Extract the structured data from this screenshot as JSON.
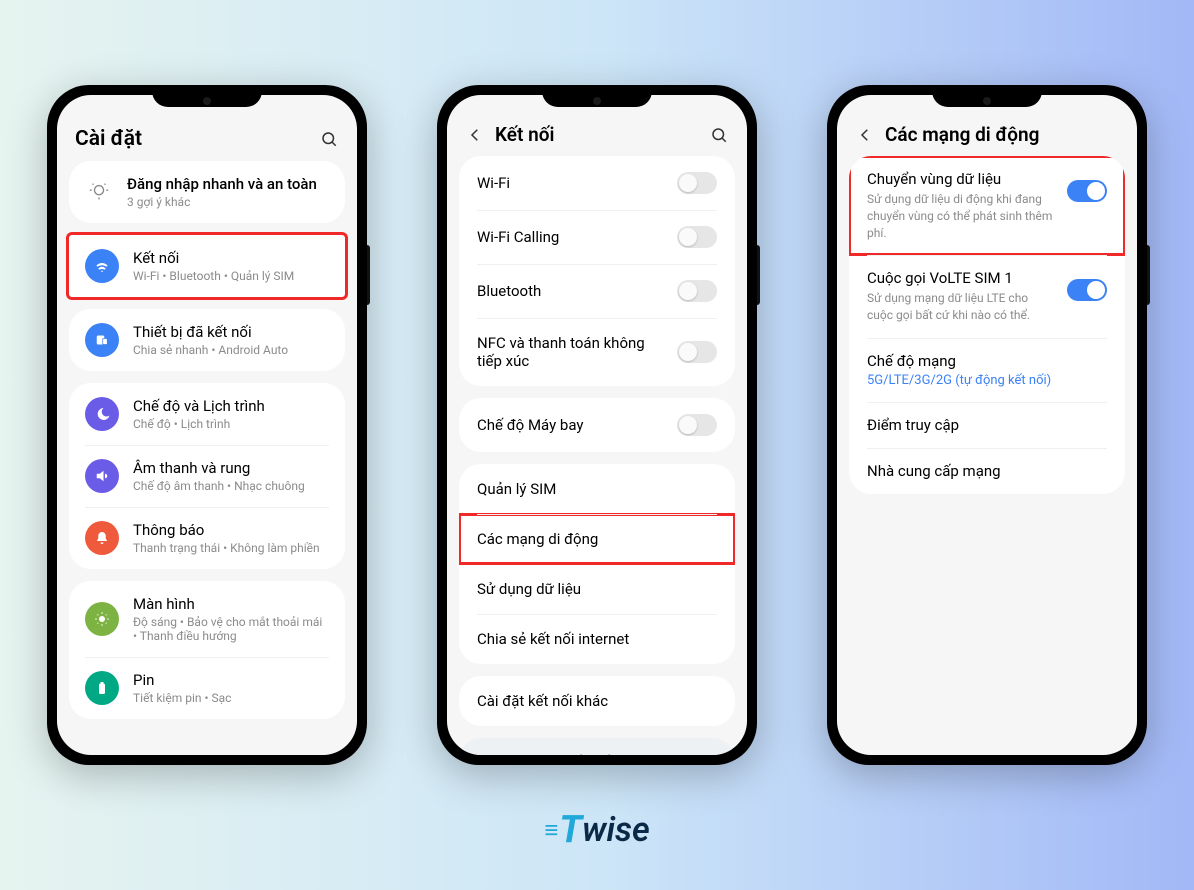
{
  "watermark": {
    "t": "T",
    "wise": "wise"
  },
  "phone1": {
    "title": "Cài đặt",
    "tip": {
      "title": "Đăng nhập nhanh và an toàn",
      "sub": "3 gợi ý khác"
    },
    "rows": [
      {
        "title": "Kết nối",
        "sub": "Wi-Fi • Bluetooth • Quản lý SIM",
        "color": "#3b82f6",
        "icon": "wifi",
        "hl": true
      },
      {
        "title": "Thiết bị đã kết nối",
        "sub": "Chia sẻ nhanh • Android Auto",
        "color": "#3b82f6",
        "icon": "devices"
      }
    ],
    "rows2": [
      {
        "title": "Chế độ và Lịch trình",
        "sub": "Chế độ • Lịch trình",
        "color": "#6b5ce7",
        "icon": "moon"
      },
      {
        "title": "Âm thanh và rung",
        "sub": "Chế độ âm thanh • Nhạc chuông",
        "color": "#6b5ce7",
        "icon": "sound"
      },
      {
        "title": "Thông báo",
        "sub": "Thanh trạng thái • Không làm phiền",
        "color": "#f05a3c",
        "icon": "bell"
      }
    ],
    "rows3": [
      {
        "title": "Màn hình",
        "sub": "Độ sáng • Bảo vệ cho mắt thoải mái • Thanh điều hướng",
        "color": "#7cb342",
        "icon": "display"
      },
      {
        "title": "Pin",
        "sub": "Tiết kiệm pin • Sạc",
        "color": "#00a884",
        "icon": "battery"
      }
    ]
  },
  "phone2": {
    "title": "Kết nối",
    "group1": [
      {
        "title": "Wi-Fi",
        "toggle": "off"
      },
      {
        "title": "Wi-Fi Calling",
        "toggle": "off"
      },
      {
        "title": "Bluetooth",
        "toggle": "off"
      },
      {
        "title": "NFC và thanh toán không tiếp xúc",
        "toggle": "off"
      }
    ],
    "group2": [
      {
        "title": "Chế độ Máy bay",
        "toggle": "off"
      }
    ],
    "group3": [
      {
        "title": "Quản lý SIM"
      },
      {
        "title": "Các mạng di động",
        "hl": true
      },
      {
        "title": "Sử dụng dữ liệu"
      },
      {
        "title": "Chia sẻ kết nối internet"
      }
    ],
    "group4": [
      {
        "title": "Cài đặt kết nối khác"
      }
    ],
    "footer": "Bạn đang tìm kiếm điều gì khác?"
  },
  "phone3": {
    "title": "Các mạng di động",
    "rows": [
      {
        "title": "Chuyển vùng dữ liệu",
        "sub": "Sử dụng dữ liệu di động khi đang chuyển vùng có thể phát sinh thêm phí.",
        "toggle": "on",
        "hl": true
      },
      {
        "title": "Cuộc gọi VoLTE SIM 1",
        "sub": "Sử dụng mạng dữ liệu LTE cho cuộc gọi bất cứ khi nào có thể.",
        "toggle": "on"
      },
      {
        "title": "Chế độ mạng",
        "blue": "5G/LTE/3G/2G (tự động kết nối)"
      },
      {
        "title": "Điểm truy cập"
      },
      {
        "title": "Nhà cung cấp mạng"
      }
    ]
  }
}
